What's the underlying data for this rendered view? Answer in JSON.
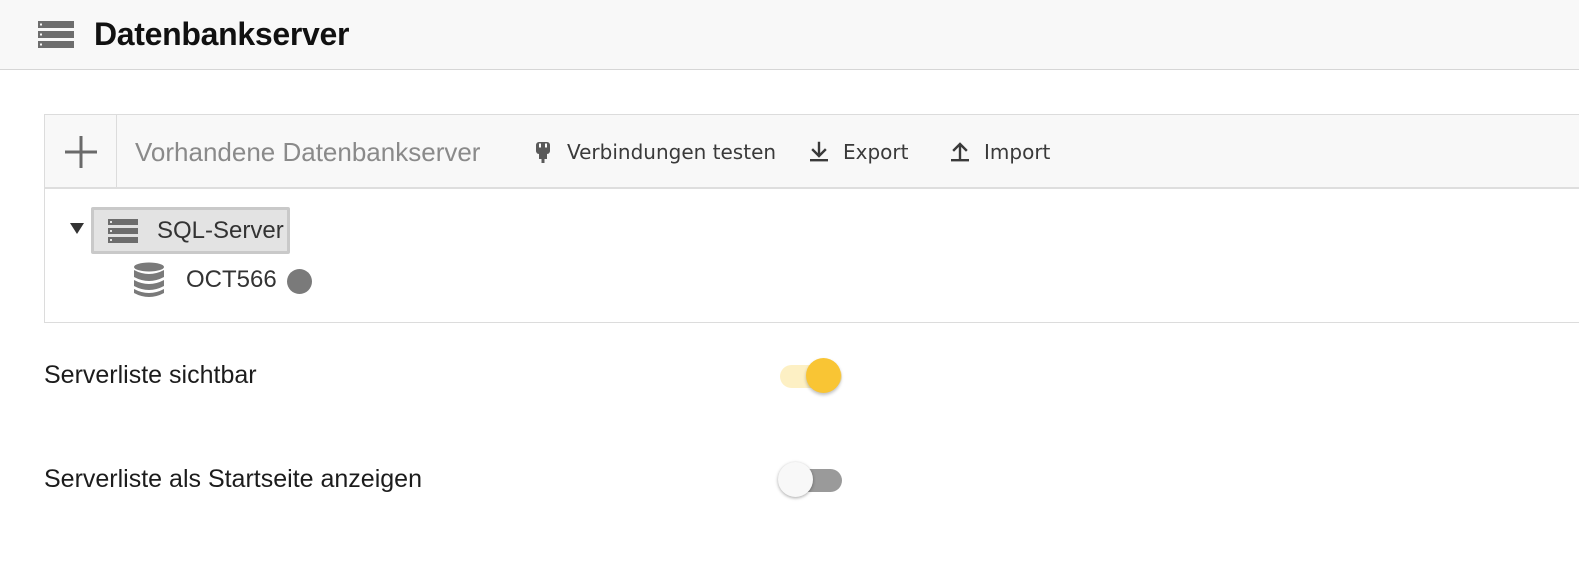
{
  "header": {
    "title": "Datenbankserver",
    "icon": "server-rack-icon"
  },
  "server_panel": {
    "toolbar": {
      "add_icon": "plus-icon",
      "title": "Vorhandene Datenbankserver",
      "test_label": "Verbindungen testen",
      "test_icon": "plug-icon",
      "export_label": "Export",
      "export_icon": "download-icon",
      "import_label": "Import",
      "import_icon": "upload-icon"
    },
    "tree": {
      "expanded": true,
      "server": {
        "label": "SQL-Server",
        "icon": "server-rack-icon",
        "selected": true
      },
      "databases": [
        {
          "label": "OCT566",
          "icon": "database-icon",
          "status_color": "#7a7a7a"
        }
      ]
    }
  },
  "settings": {
    "server_list_visible": {
      "label": "Serverliste sichtbar",
      "enabled": true
    },
    "server_list_start_page": {
      "label": "Serverliste als Startseite anzeigen",
      "enabled": false
    }
  },
  "colors": {
    "accent": "#f9c534",
    "accent_track": "#fdf0c4",
    "toolbar_bg": "#f8f8f8",
    "icon_gray": "#707070"
  }
}
